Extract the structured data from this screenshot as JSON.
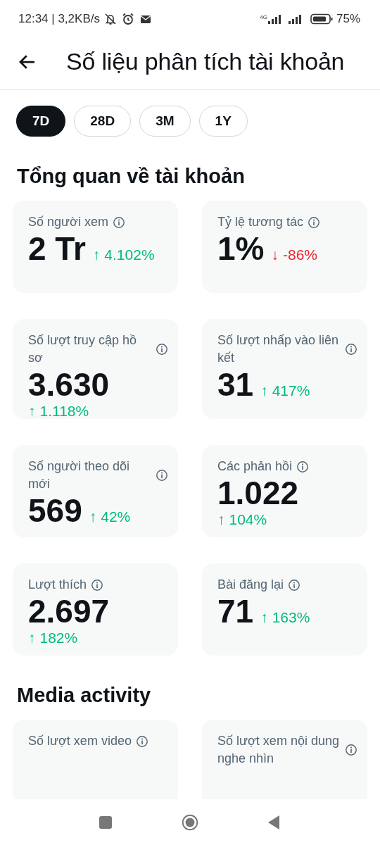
{
  "status_bar": {
    "time": "12:34 | 3,2KB/s",
    "network": "4G",
    "battery": "75%"
  },
  "header": {
    "title": "Số liệu phân tích tài khoản"
  },
  "periods": [
    {
      "label": "7D",
      "selected": true
    },
    {
      "label": "28D",
      "selected": false
    },
    {
      "label": "3M",
      "selected": false
    },
    {
      "label": "1Y",
      "selected": false
    }
  ],
  "sections": [
    {
      "title": "Tổng quan về tài khoản",
      "cards": [
        {
          "label": "Số người xem",
          "value": "2 Tr",
          "kind": "inline",
          "delta": {
            "negative": false,
            "arrow": "↑",
            "text": "4.102%"
          }
        },
        {
          "label": "Tỷ lệ tương tác",
          "value": "1%",
          "kind": "inline",
          "delta": {
            "negative": true,
            "arrow": "↓",
            "text": "-86%"
          }
        },
        {
          "label": "Số lượt truy cập hồ sơ",
          "value": "3.630",
          "kind": "stacked",
          "delta": {
            "negative": false,
            "arrow": "↑",
            "text": "1.118%"
          }
        },
        {
          "label": "Số lượt nhấp vào liên kết",
          "value": "31",
          "kind": "inline",
          "delta": {
            "negative": false,
            "arrow": "↑",
            "text": "417%"
          }
        },
        {
          "label": "Số người theo dõi mới",
          "value": "569",
          "kind": "inline",
          "delta": {
            "negative": false,
            "arrow": "↑",
            "text": "42%"
          }
        },
        {
          "label": "Các phản hồi",
          "value": "1.022",
          "kind": "stacked",
          "delta": {
            "negative": false,
            "arrow": "↑",
            "text": "104%"
          }
        },
        {
          "label": "Lượt thích",
          "value": "2.697",
          "kind": "stacked",
          "delta": {
            "negative": false,
            "arrow": "↑",
            "text": "182%"
          }
        },
        {
          "label": "Bài đăng lại",
          "value": "71",
          "kind": "inline",
          "delta": {
            "negative": false,
            "arrow": "↑",
            "text": "163%"
          }
        }
      ]
    },
    {
      "title": "Media activity",
      "cards": [
        {
          "label": "Số lượt xem video"
        },
        {
          "label": "Số lượt xem nội dung nghe nhìn"
        }
      ]
    }
  ]
}
